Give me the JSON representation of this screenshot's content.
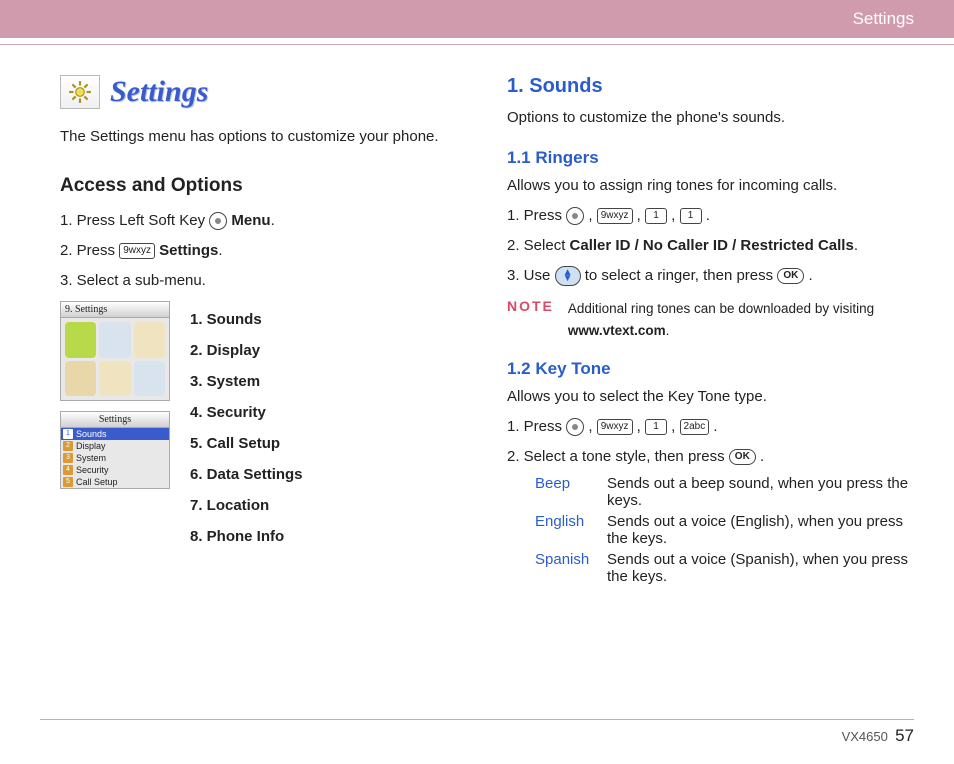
{
  "header": {
    "title": "Settings"
  },
  "left": {
    "title": "Settings",
    "intro": "The Settings menu has options to customize your phone.",
    "accessHeading": "Access and Options",
    "step1_pre": "1.  Press Left Soft Key ",
    "step1_post": "Menu",
    "step2_pre": "2.  Press ",
    "step2_key": "9wxyz",
    "step2_post": "Settings",
    "step3": "3.  Select a sub-menu.",
    "screen1_title": "9. Settings",
    "screen2_title": "Settings",
    "screen2_rows": [
      "Sounds",
      "Display",
      "System",
      "Security",
      "Call Setup"
    ],
    "submenu": [
      "1. Sounds",
      "2. Display",
      "3. System",
      "4. Security",
      "5. Call Setup",
      "6. Data Settings",
      "7. Location",
      "8. Phone Info"
    ]
  },
  "right": {
    "soundsHeading": "1. Sounds",
    "soundsIntro": "Options to customize the phone's sounds.",
    "ringersHeading": "1.1 Ringers",
    "ringersIntro": "Allows you to assign ring tones for incoming calls.",
    "r_step1_pre": "1.  Press ",
    "k9": "9wxyz",
    "k1a": "1",
    "k1b": "1",
    "r_step2_pre": "2.  Select ",
    "r_step2_bold": "Caller ID / No Caller ID / Restricted Calls",
    "r_step3_pre": "3.  Use ",
    "r_step3_mid": " to select a ringer, then press ",
    "noteLabel": "NOTE",
    "noteText_a": "Additional ring tones can be downloaded by visiting ",
    "noteText_b": "www.vtext.com",
    "keytoneHeading": "1.2 Key Tone",
    "keytoneIntro": "Allows you to select the Key Tone type.",
    "kt_step1_pre": "1.    Press ",
    "kt_k2": "2abc",
    "kt_step2_pre": "2.  Select a tone style, then press ",
    "tones": [
      {
        "label": "Beep",
        "desc": "Sends out a beep sound, when you press the keys."
      },
      {
        "label": "English",
        "desc": "Sends out a voice (English), when you press the keys."
      },
      {
        "label": "Spanish",
        "desc": "Sends out a voice (Spanish), when you press the keys."
      }
    ]
  },
  "footer": {
    "model": "VX4650",
    "page": "57"
  }
}
